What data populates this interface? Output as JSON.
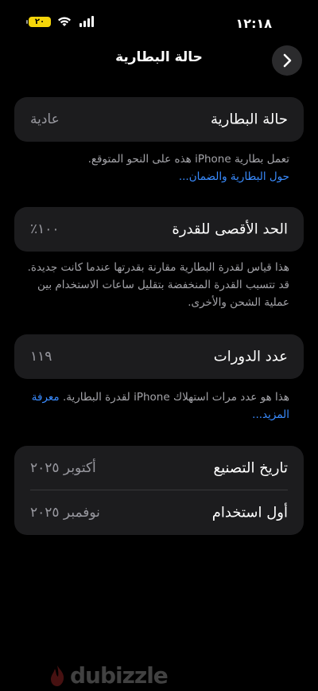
{
  "status_bar": {
    "time": "١٢:١٨",
    "battery_level": "٢٠",
    "icons": [
      "battery-icon",
      "wifi-icon",
      "cellular-signal-icon"
    ],
    "battery_color": "#f5d50a"
  },
  "nav": {
    "title": "حالة البطارية",
    "back_icon": "chevron-right-icon"
  },
  "battery_state": {
    "label": "حالة البطارية",
    "value": "عادية",
    "note": "تعمل بطارية iPhone هذه على النحو المتوقع.",
    "link": "حول البطارية والضمان..."
  },
  "max_capacity": {
    "label": "الحد الأقصى للقدرة",
    "value": "٪١٠٠",
    "note": "هذا قياس لقدرة البطارية مقارنة بقدرتها عندما كانت جديدة. قد تتسبب القدرة المنخفضة بتقليل ساعات الاستخدام بين عملية الشحن والأخرى."
  },
  "cycle_count": {
    "label": "عدد الدورات",
    "value": "١١٩",
    "note": "هذا هو عدد مرات استهلاك iPhone لقدرة البطارية.",
    "link": "معرفة المزيد..."
  },
  "dates": {
    "manufacture_label": "تاريخ التصنيع",
    "manufacture_value": "أكتوبر ٢٠٢٥",
    "first_use_label": "أول استخدام",
    "first_use_value": "نوفمبر ٢٠٢٥"
  },
  "watermark": {
    "text": "dubizzle"
  },
  "colors": {
    "background": "#000000",
    "card": "#1c1c1e",
    "secondary_text": "#98989f",
    "link": "#3a8cff"
  }
}
